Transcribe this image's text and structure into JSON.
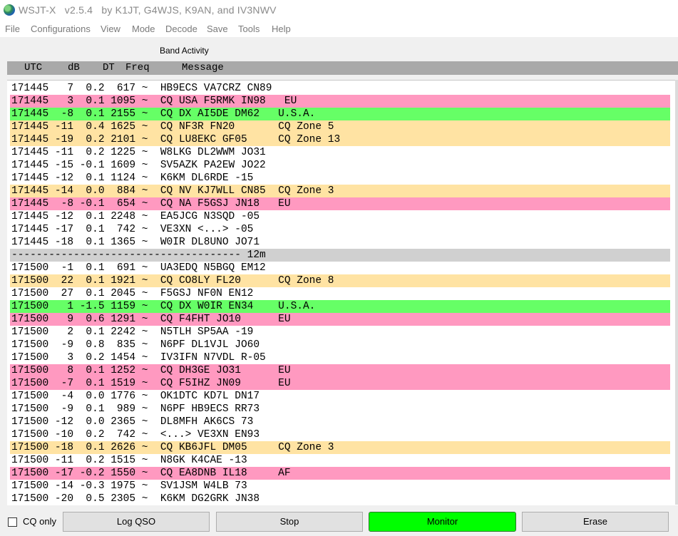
{
  "window": {
    "title": "WSJT-X   v2.5.4   by K1JT, G4WJS, K9AN, and IV3NWV"
  },
  "menu": [
    "File",
    "Configurations",
    "View",
    "Mode",
    "Decode",
    "Save",
    "Tools",
    "Help"
  ],
  "band_activity": {
    "label": "Band Activity",
    "headers": {
      "utc": "UTC",
      "db": "dB",
      "dt": "DT",
      "freq": "Freq",
      "message": "Message"
    },
    "colors": {
      "cq_region": "#ff99c0",
      "cq_zone": "#ffe3a3",
      "cq_dx_new": "#66ff66",
      "separator": "#d0d0d0",
      "normal": "#ffffff"
    },
    "rows": [
      {
        "text": "171445   7  0.2  617 ~  HB9ECS VA7CRZ CN89",
        "bg": "#ffffff"
      },
      {
        "text": "171445   3  0.1 1095 ~  CQ USA F5RMK IN98   EU",
        "bg": "#ff99c0"
      },
      {
        "text": "171445  -8  0.1 2155 ~  CQ DX AI5DE DM62   U.S.A.",
        "bg": "#66ff66"
      },
      {
        "text": "171445 -11  0.4 1625 ~  CQ NF3R FN20       CQ Zone 5",
        "bg": "#ffe3a3"
      },
      {
        "text": "171445 -19  0.2 2101 ~  CQ LU8EKC GF05     CQ Zone 13",
        "bg": "#ffe3a3"
      },
      {
        "text": "171445 -11  0.2 1225 ~  W8LKG DL2WWM JO31",
        "bg": "#ffffff"
      },
      {
        "text": "171445 -15 -0.1 1609 ~  SV5AZK PA2EW JO22",
        "bg": "#ffffff"
      },
      {
        "text": "171445 -12  0.1 1124 ~  K6KM DL6RDE -15",
        "bg": "#ffffff"
      },
      {
        "text": "171445 -14  0.0  884 ~  CQ NV KJ7WLL CN85  CQ Zone 3",
        "bg": "#ffe3a3"
      },
      {
        "text": "171445  -8 -0.1  654 ~  CQ NA F5GSJ JN18   EU",
        "bg": "#ff99c0"
      },
      {
        "text": "171445 -12  0.1 2248 ~  EA5JCG N3SQD -05",
        "bg": "#ffffff"
      },
      {
        "text": "171445 -17  0.1  742 ~  VE3XN <...> -05",
        "bg": "#ffffff"
      },
      {
        "text": "171445 -18  0.1 1365 ~  W0IR DL8UNO JO71",
        "bg": "#ffffff"
      },
      {
        "text": "------------------------------------- 12m",
        "bg": "#d0d0d0"
      },
      {
        "text": "171500  -1  0.1  691 ~  UA3EDQ N5BGQ EM12",
        "bg": "#ffffff"
      },
      {
        "text": "171500  22  0.1 1921 ~  CQ CO8LY FL20      CQ Zone 8",
        "bg": "#ffe3a3"
      },
      {
        "text": "171500  27  0.1 2045 ~  F5GSJ NF0N EN12",
        "bg": "#ffffff"
      },
      {
        "text": "171500   1 -1.5 1159 ~  CQ DX W0IR EN34    U.S.A.",
        "bg": "#66ff66"
      },
      {
        "text": "171500   9  0.6 1291 ~  CQ F4FHT JO10      EU",
        "bg": "#ff99c0"
      },
      {
        "text": "171500   2  0.1 2242 ~  N5TLH SP5AA -19",
        "bg": "#ffffff"
      },
      {
        "text": "171500  -9  0.8  835 ~  N6PF DL1VJL JO60",
        "bg": "#ffffff"
      },
      {
        "text": "171500   3  0.2 1454 ~  IV3IFN N7VDL R-05",
        "bg": "#ffffff"
      },
      {
        "text": "171500   8  0.1 1252 ~  CQ DH3GE JO31      EU",
        "bg": "#ff99c0"
      },
      {
        "text": "171500  -7  0.1 1519 ~  CQ F5IHZ JN09      EU",
        "bg": "#ff99c0"
      },
      {
        "text": "171500  -4  0.0 1776 ~  OK1DTC KD7L DN17",
        "bg": "#ffffff"
      },
      {
        "text": "171500  -9  0.1  989 ~  N6PF HB9ECS RR73",
        "bg": "#ffffff"
      },
      {
        "text": "171500 -12  0.0 2365 ~  DL8MFH AK6CS 73",
        "bg": "#ffffff"
      },
      {
        "text": "171500 -10  0.2  742 ~  <...> VE3XN EN93",
        "bg": "#ffffff"
      },
      {
        "text": "171500 -18  0.1 2626 ~  CQ KB6JFL DM05     CQ Zone 3",
        "bg": "#ffe3a3"
      },
      {
        "text": "171500 -11  0.2 1515 ~  N8GK K4CAE -13",
        "bg": "#ffffff"
      },
      {
        "text": "171500 -17 -0.2 1550 ~  CQ EA8DNB IL18     AF",
        "bg": "#ff99c0"
      },
      {
        "text": "171500 -14 -0.3 1975 ~  SV1JSM W4LB 73",
        "bg": "#ffffff"
      },
      {
        "text": "171500 -20  0.5 2305 ~  K6KM DG2GRK JN38",
        "bg": "#ffffff"
      }
    ]
  },
  "controls": {
    "cq_only": {
      "label": "CQ only",
      "checked": false
    },
    "log_qso": "Log QSO",
    "stop": "Stop",
    "monitor": "Monitor",
    "monitor_color": "#00ff00",
    "erase": "Erase"
  }
}
